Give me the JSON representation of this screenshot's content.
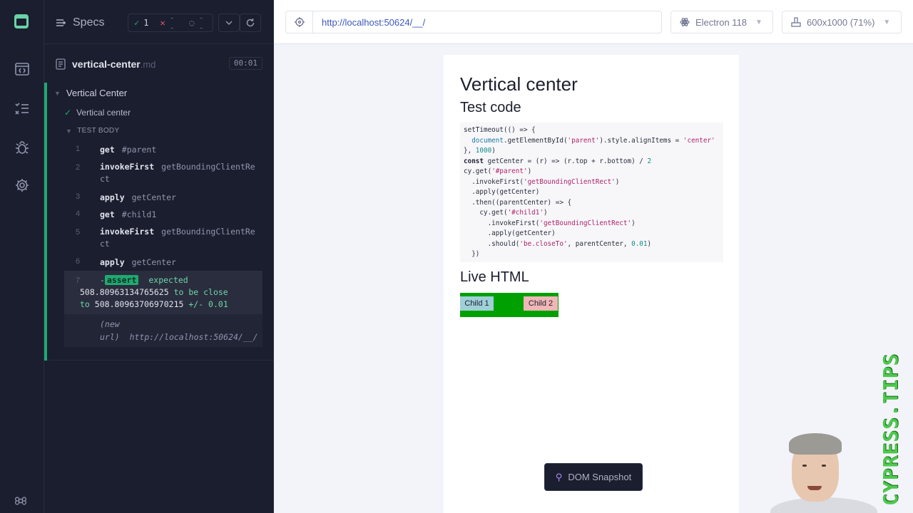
{
  "reporter": {
    "specs_label": "Specs",
    "stats": {
      "passed": "1",
      "failed": "--",
      "pending": "--"
    },
    "spec": {
      "name": "vertical-center",
      "ext": ".md",
      "duration": "00:01"
    },
    "suite_title": "Vertical Center",
    "test_title": "Vertical center",
    "body_label": "TEST BODY",
    "commands": [
      {
        "num": "1",
        "name": "get",
        "arg": "#parent"
      },
      {
        "num": "2",
        "name": "invokeFirst",
        "arg": "getBoundingClientRect"
      },
      {
        "num": "3",
        "name": "apply",
        "arg": "getCenter"
      },
      {
        "num": "4",
        "name": "get",
        "arg": "#child1"
      },
      {
        "num": "5",
        "name": "invokeFirst",
        "arg": "getBoundingClientRect"
      },
      {
        "num": "6",
        "name": "apply",
        "arg": "getCenter"
      }
    ],
    "assert": {
      "num": "7",
      "tilde": "-",
      "badge": "assert",
      "expected": "expected",
      "value1": "508.80963134765625",
      "middle": "to be close",
      "to": "to",
      "value2": "508.80963706970215",
      "tolerance": "+/- 0.01"
    },
    "new_url": {
      "label1": "(new",
      "label2": "url)",
      "url": "http://localhost:50624/__/"
    }
  },
  "topbar": {
    "url": "http://localhost:50624/__/",
    "browser": "Electron 118",
    "viewport": "600x1000 (71%)"
  },
  "aut": {
    "h1": "Vertical center",
    "test_code_heading": "Test code",
    "live_html_heading": "Live HTML",
    "child1": "Child 1",
    "child2": "Child 2"
  },
  "dom_snapshot_label": "DOM Snapshot",
  "watermark": "CYPRESS.TIPS",
  "icons": [
    "cypress-logo-icon",
    "runs-icon",
    "list-icon",
    "debug-icon",
    "settings-icon",
    "keyboard-shortcut-icon"
  ],
  "colors": {
    "pass": "#1fa971",
    "fail": "#e45770",
    "url": "#3b58c0",
    "parent_bg": "#00a000"
  }
}
